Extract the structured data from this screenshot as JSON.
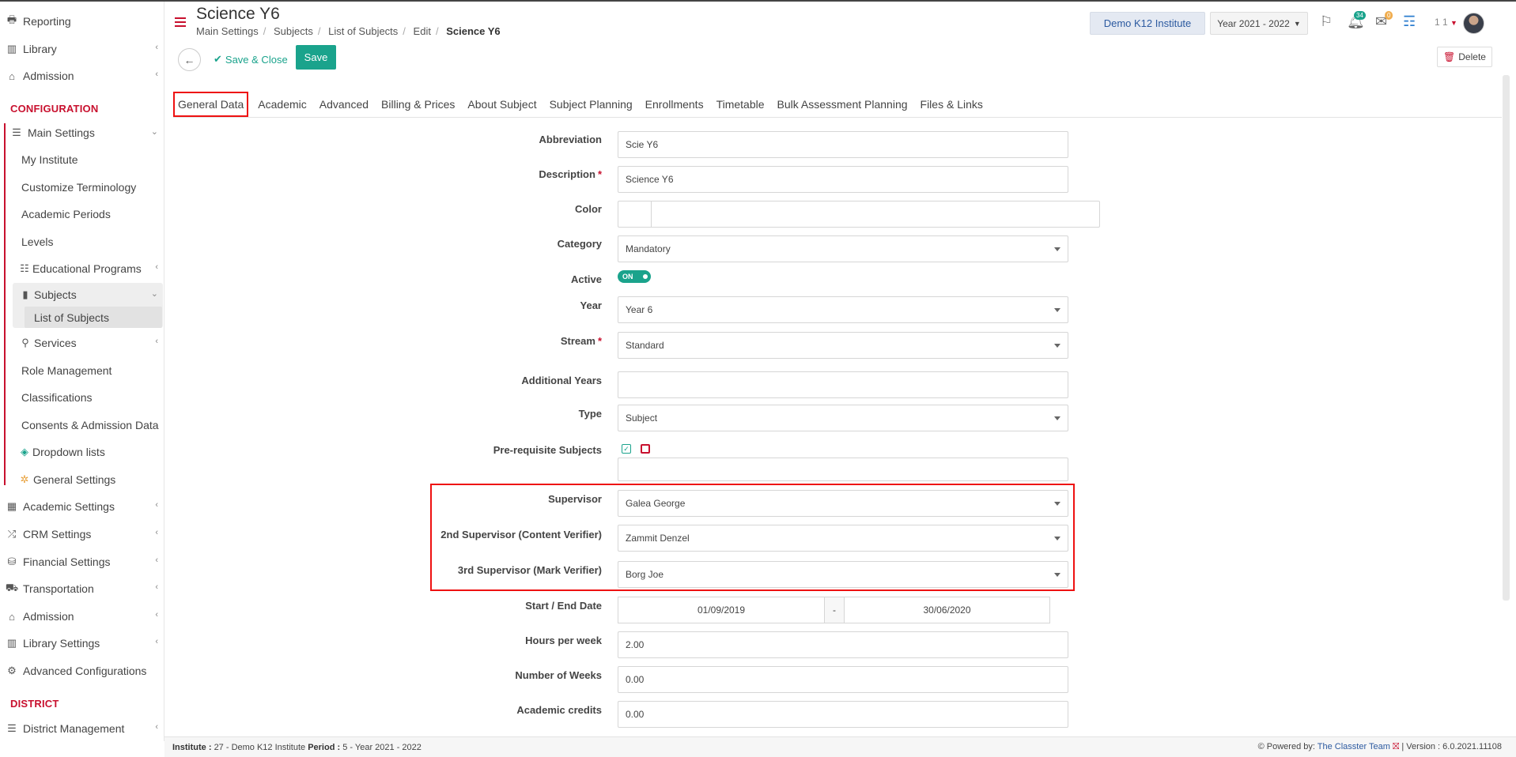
{
  "sidebar": {
    "top_items": [
      {
        "label": "Reporting",
        "icon": "printer-icon",
        "glyph": "🖶"
      },
      {
        "label": "Library",
        "icon": "books-icon",
        "glyph": "▥"
      },
      {
        "label": "Admission",
        "icon": "institution-icon",
        "glyph": "⌂"
      }
    ],
    "configuration_heading": "CONFIGURATION",
    "main_settings": "Main Settings",
    "main_children": [
      "My Institute",
      "Customize Terminology",
      "Academic Periods",
      "Levels",
      "Educational Programs",
      "Subjects",
      "List of Subjects",
      "Services",
      "Role Management",
      "Classifications",
      "Consents & Admission Data",
      "Dropdown lists",
      "General Settings"
    ],
    "lower_items": [
      "Academic Settings",
      "CRM Settings",
      "Financial Settings",
      "Transportation",
      "Admission",
      "Library Settings",
      "Advanced Configurations"
    ],
    "district_heading": "DISTRICT",
    "district_item": "District Management"
  },
  "header": {
    "title": "Science Y6",
    "breadcrumb": [
      "Main Settings",
      "Subjects",
      "List of Subjects",
      "Edit",
      "Science Y6"
    ],
    "institute": "Demo K12 Institute",
    "year": "Year 2021 - 2022",
    "notif_count": "34",
    "mail_count": "0",
    "user_short": "1 1"
  },
  "toolbar": {
    "save_close": "Save & Close",
    "save": "Save",
    "delete": "Delete"
  },
  "tabs": [
    "General Data",
    "Academic",
    "Advanced",
    "Billing & Prices",
    "About Subject",
    "Subject Planning",
    "Enrollments",
    "Timetable",
    "Bulk Assessment Planning",
    "Files & Links"
  ],
  "form": {
    "abbreviation": {
      "label": "Abbreviation",
      "value": "Scie Y6"
    },
    "description": {
      "label": "Description",
      "value": "Science Y6"
    },
    "color": {
      "label": "Color"
    },
    "category": {
      "label": "Category",
      "value": "Mandatory"
    },
    "active": {
      "label": "Active",
      "value": "ON"
    },
    "year": {
      "label": "Year",
      "value": "Year 6"
    },
    "stream": {
      "label": "Stream",
      "value": "Standard"
    },
    "additional_years": {
      "label": "Additional Years",
      "value": ""
    },
    "type": {
      "label": "Type",
      "value": "Subject"
    },
    "prereq": {
      "label": "Pre-requisite Subjects"
    },
    "supervisor": {
      "label": "Supervisor",
      "value": "Galea George"
    },
    "supervisor2": {
      "label": "2nd Supervisor (Content Verifier)",
      "value": "Zammit Denzel"
    },
    "supervisor3": {
      "label": "3rd Supervisor (Mark Verifier)",
      "value": "Borg Joe"
    },
    "dates": {
      "label": "Start / End Date",
      "start": "01/09/2019",
      "sep": "-",
      "end": "30/06/2020"
    },
    "hours": {
      "label": "Hours per week",
      "value": "2.00"
    },
    "weeks": {
      "label": "Number of Weeks",
      "value": "0.00"
    },
    "credits": {
      "label": "Academic credits",
      "value": "0.00"
    }
  },
  "footer": {
    "institute_label": "Institute :",
    "institute_value": "27 - Demo K12 Institute",
    "period_label": "Period :",
    "period_value": "5 - Year 2021 - 2022",
    "powered": "Powered by:",
    "team": "The Classter Team",
    "version": "| Version : 6.0.2021.11108"
  },
  "colors": {
    "accent": "#1aa38c",
    "brand_red": "#c8102e",
    "highlight": "#ee1111"
  }
}
